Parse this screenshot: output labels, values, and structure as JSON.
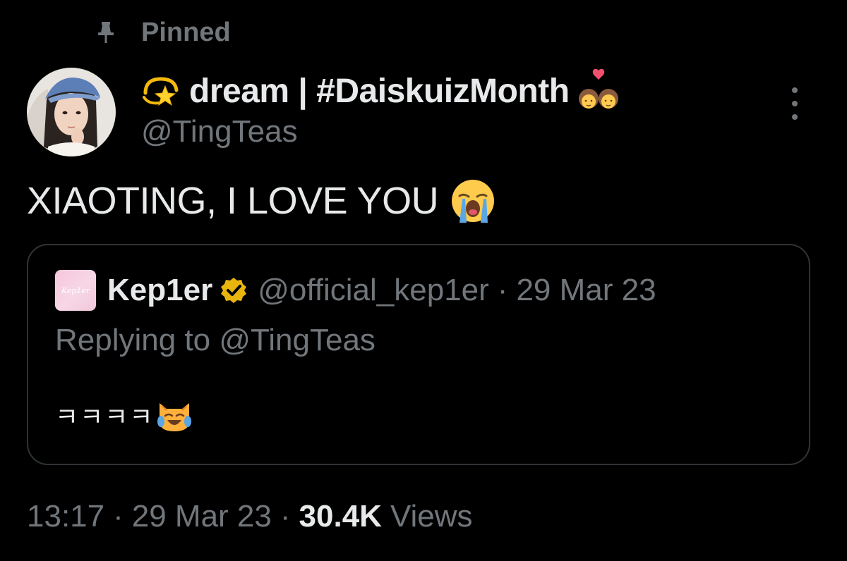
{
  "pinned": {
    "label": "Pinned",
    "icon": "pin-icon"
  },
  "author": {
    "display_name": "dream | #DaiskuizMonth",
    "handle": "@TingTeas",
    "name_prefix_icon": "sparkle-star-emoji",
    "name_suffix_icon": "couple-with-heart-emoji"
  },
  "tweet": {
    "text": "XIAOTING, I LOVE YOU",
    "emoji": "loudly-crying-face-emoji"
  },
  "quote": {
    "author_name": "Kep1er",
    "avatar_text": "Kep1er",
    "verified_color": "#e8b50e",
    "handle": "@official_kep1er",
    "separator": "·",
    "date": "29 Mar 23",
    "replying_to": "Replying to @TingTeas",
    "body": "ㅋㅋㅋㅋ",
    "body_emoji": "cat-with-tears-of-joy-emoji"
  },
  "footer": {
    "time": "13:17",
    "separator": "·",
    "date": "29 Mar 23",
    "views_count": "30.4K",
    "views_label": "Views"
  },
  "colors": {
    "background": "#000000",
    "primary_text": "#e7e9ea",
    "secondary_text": "#71767b",
    "border": "#2f3336"
  }
}
